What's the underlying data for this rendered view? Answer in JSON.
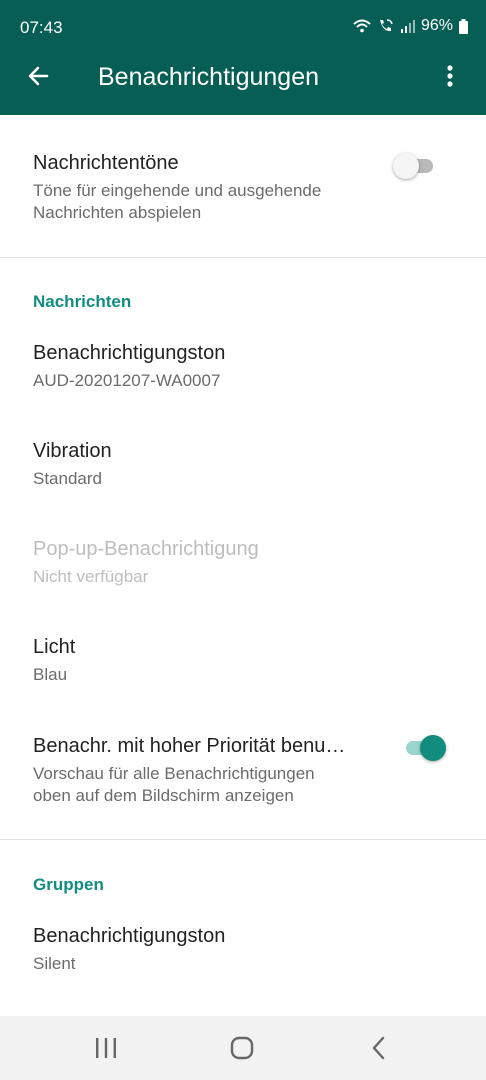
{
  "status_bar": {
    "time": "07:43",
    "battery": "96%"
  },
  "app_bar": {
    "title": "Benachrichtigungen"
  },
  "conversation_tones": {
    "title": "Nachrichtentöne",
    "subtitle_line1": "Töne für eingehende und ausgehende",
    "subtitle_line2": "Nachrichten abspielen",
    "enabled": false
  },
  "messages": {
    "header": "Nachrichten",
    "notification_tone": {
      "title": "Benachrichtigungston",
      "value": "AUD-20201207-WA0007"
    },
    "vibration": {
      "title": "Vibration",
      "value": "Standard"
    },
    "popup": {
      "title": "Pop-up-Benachrichtigung",
      "value": "Nicht verfügbar",
      "disabled": true
    },
    "light": {
      "title": "Licht",
      "value": "Blau"
    },
    "high_priority": {
      "title": "Benachr. mit hoher Priorität benu…",
      "subtitle_line1": "Vorschau für alle Benachrichtigungen",
      "subtitle_line2": "oben auf dem Bildschirm anzeigen",
      "enabled": true
    }
  },
  "groups": {
    "header": "Gruppen",
    "notification_tone": {
      "title": "Benachrichtigungston",
      "value": "Silent"
    }
  },
  "colors": {
    "toolbar": "#075e54",
    "accent": "#128c7e"
  },
  "icons": {
    "back": "arrow-back-icon",
    "more": "more-vert-icon",
    "wifi": "wifi-icon",
    "wifi_call": "wifi-call-icon",
    "signal": "signal-icon",
    "battery": "battery-icon",
    "recents": "recents-icon",
    "home": "home-icon",
    "nav_back": "nav-back-icon"
  }
}
